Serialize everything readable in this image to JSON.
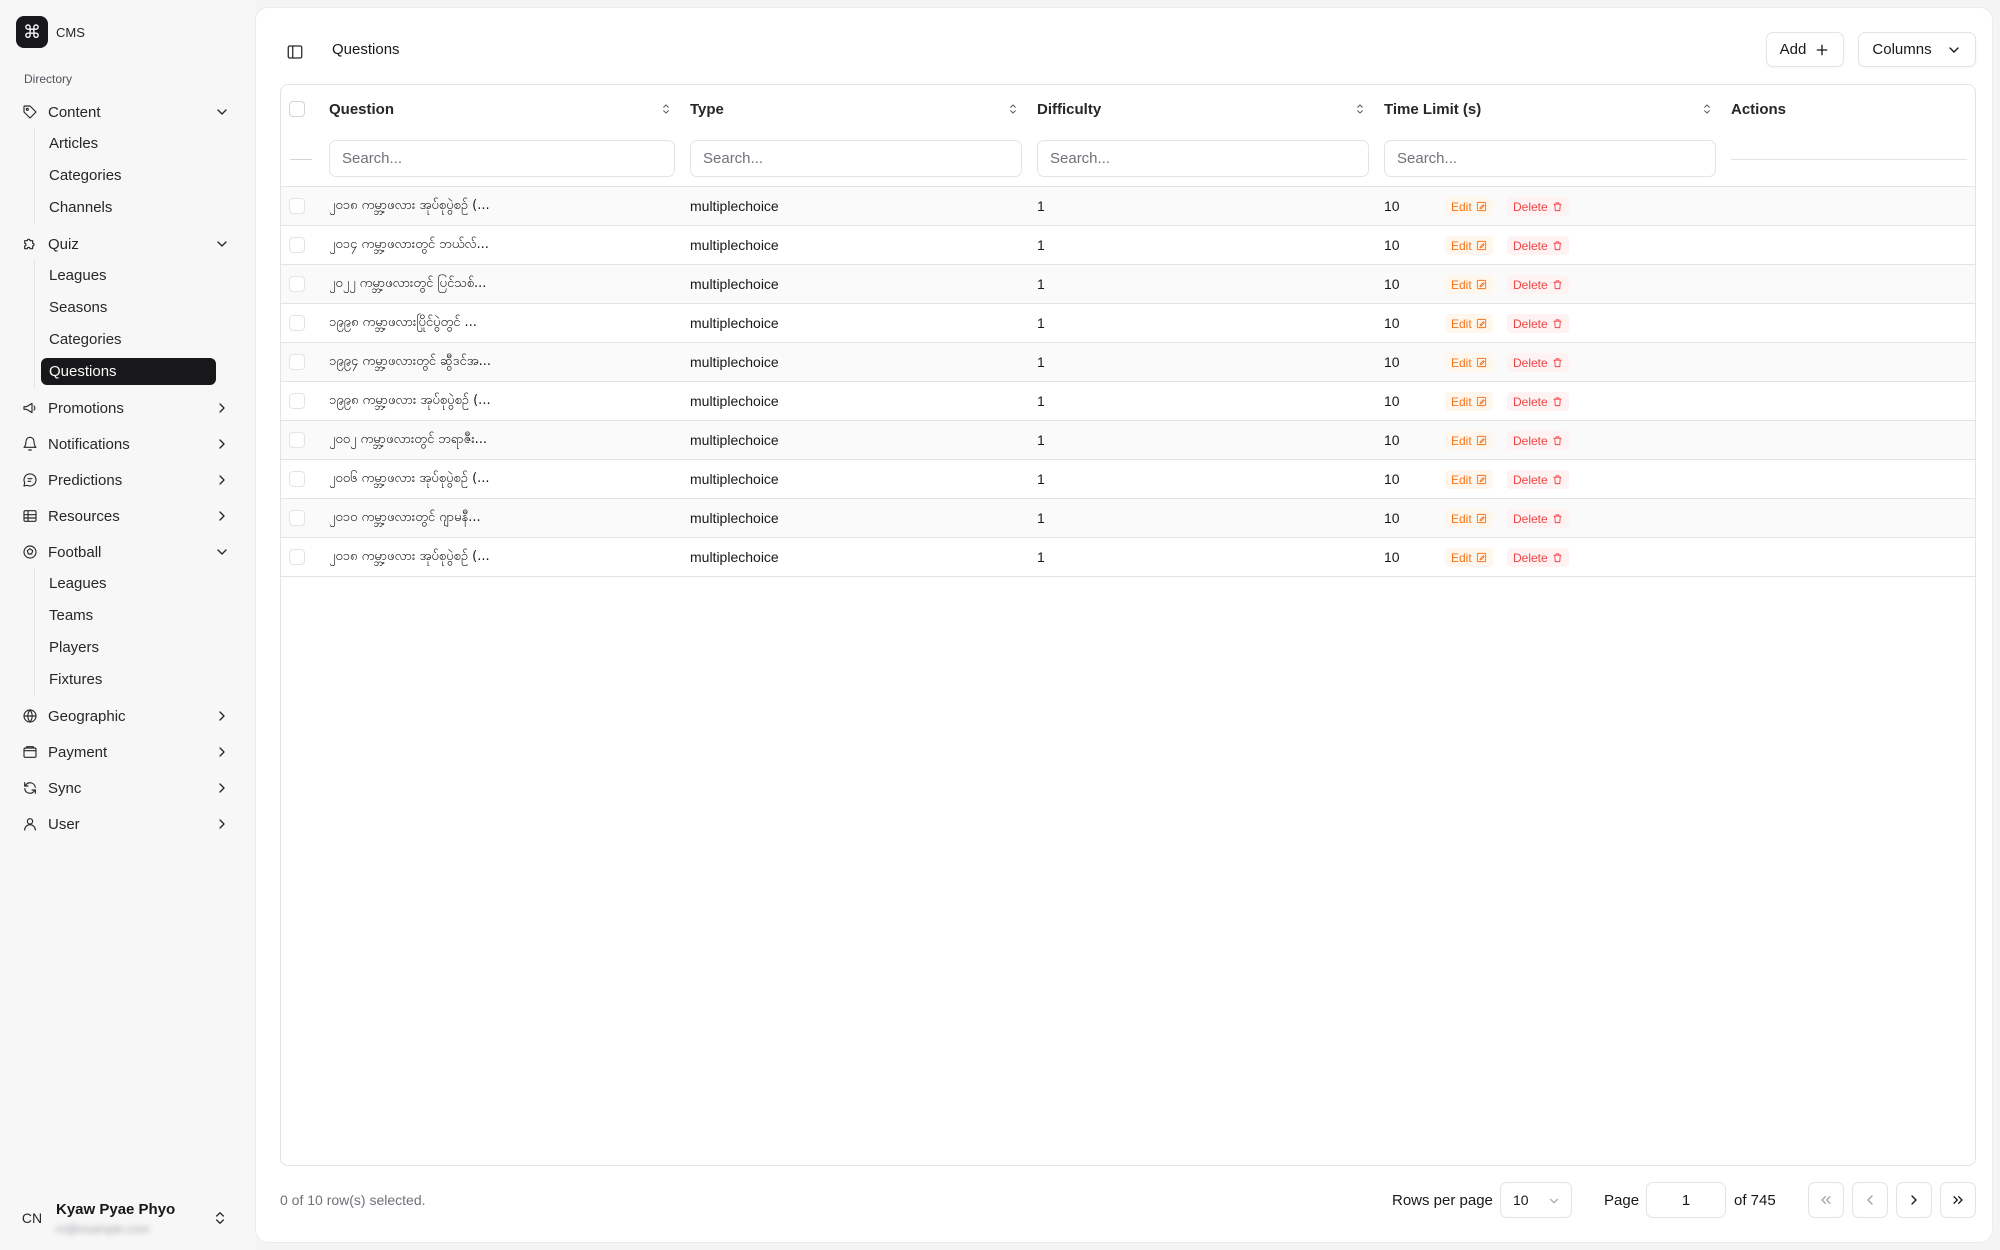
{
  "app": {
    "name": "CMS"
  },
  "sidebar": {
    "section_label": "Directory",
    "content": {
      "label": "Content",
      "items": [
        "Articles",
        "Categories",
        "Channels"
      ]
    },
    "quiz": {
      "label": "Quiz",
      "items": [
        "Leagues",
        "Seasons",
        "Categories",
        "Questions"
      ],
      "active": "Questions"
    },
    "promotions": {
      "label": "Promotions"
    },
    "notifications": {
      "label": "Notifications"
    },
    "predictions": {
      "label": "Predictions"
    },
    "resources": {
      "label": "Resources"
    },
    "football": {
      "label": "Football",
      "items": [
        "Leagues",
        "Teams",
        "Players",
        "Fixtures"
      ]
    },
    "geographic": {
      "label": "Geographic"
    },
    "payment": {
      "label": "Payment"
    },
    "sync": {
      "label": "Sync"
    },
    "user": {
      "label": "User"
    }
  },
  "user": {
    "initials": "CN",
    "name": "Kyaw Pyae Phyo",
    "email": "m@example.com"
  },
  "header": {
    "title": "Questions",
    "add_label": "Add",
    "columns_label": "Columns"
  },
  "table": {
    "columns": {
      "question": "Question",
      "type": "Type",
      "difficulty": "Difficulty",
      "time_limit": "Time Limit (s)",
      "actions": "Actions"
    },
    "filter_placeholder": "Search...",
    "edit_label": "Edit",
    "delete_label": "Delete",
    "rows": [
      {
        "question": "၂၀၁၈ ကမ္ဘာ့ဖလား အုပ်စုပွဲစဉ် (...",
        "type": "multiplechoice",
        "difficulty": "1",
        "time_limit": "10"
      },
      {
        "question": "၂၀၁၄ ကမ္ဘာ့ဖလားတွင် ဘယ်လ်...",
        "type": "multiplechoice",
        "difficulty": "1",
        "time_limit": "10"
      },
      {
        "question": "၂၀၂၂ ကမ္ဘာ့ဖလားတွင် ပြင်သစ်...",
        "type": "multiplechoice",
        "difficulty": "1",
        "time_limit": "10"
      },
      {
        "question": "၁၉၉၈ ကမ္ဘာ့ဖလားပြိုင်ပွဲတွင် ...",
        "type": "multiplechoice",
        "difficulty": "1",
        "time_limit": "10"
      },
      {
        "question": "၁၉၉၄ ကမ္ဘာ့ဖလားတွင် ဆွီဒင်အ...",
        "type": "multiplechoice",
        "difficulty": "1",
        "time_limit": "10"
      },
      {
        "question": "၁၉၉၈ ကမ္ဘာ့ဖလား အုပ်စုပွဲစဉ် (...",
        "type": "multiplechoice",
        "difficulty": "1",
        "time_limit": "10"
      },
      {
        "question": "၂၀၀၂ ကမ္ဘာ့ဖလားတွင် ဘရာဇီး...",
        "type": "multiplechoice",
        "difficulty": "1",
        "time_limit": "10"
      },
      {
        "question": "၂၀၀၆ ကမ္ဘာ့ဖလား အုပ်စုပွဲစဉ် (...",
        "type": "multiplechoice",
        "difficulty": "1",
        "time_limit": "10"
      },
      {
        "question": "၂၀၁၀ ကမ္ဘာ့ဖလားတွင် ဂျာမနီ...",
        "type": "multiplechoice",
        "difficulty": "1",
        "time_limit": "10"
      },
      {
        "question": "၂၀၁၈ ကမ္ဘာ့ဖလား အုပ်စုပွဲစဉ် (...",
        "type": "multiplechoice",
        "difficulty": "1",
        "time_limit": "10"
      }
    ]
  },
  "footer": {
    "selected_text": "0 of 10 row(s) selected.",
    "rows_per_page_label": "Rows per page",
    "rows_per_page_value": "10",
    "page_label": "Page",
    "page_value": "1",
    "of_label": "of 745"
  }
}
